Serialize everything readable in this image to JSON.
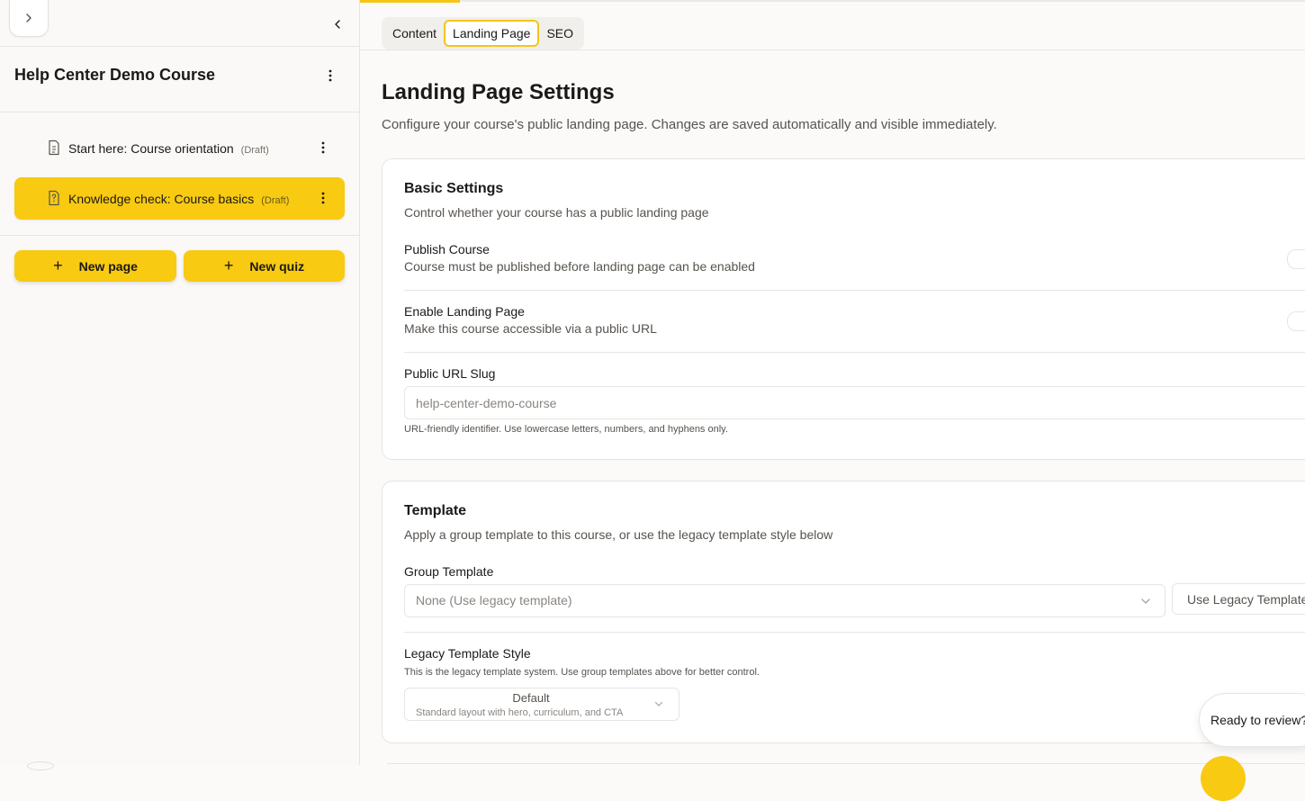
{
  "sidebar": {
    "course_title": "Help Center Demo Course",
    "items": [
      {
        "label": "Start here: Course orientation",
        "status": "(Draft)",
        "icon": "document-icon",
        "active": false
      },
      {
        "label": "Knowledge check: Course basics",
        "status": "(Draft)",
        "icon": "quiz-icon",
        "active": true
      }
    ],
    "new_page_label": "New page",
    "new_quiz_label": "New quiz"
  },
  "tabs": [
    "Content",
    "Landing Page",
    "SEO"
  ],
  "active_tab": "Landing Page",
  "page": {
    "title": "Landing Page Settings",
    "subtitle": "Configure your course's public landing page. Changes are saved automatically and visible immediately."
  },
  "basic": {
    "title": "Basic Settings",
    "subtitle": "Control whether your course has a public landing page",
    "publish_label": "Publish Course",
    "publish_desc": "Course must be published before landing page can be enabled",
    "enable_label": "Enable Landing Page",
    "enable_desc": "Make this course accessible via a public URL",
    "slug_label": "Public URL Slug",
    "slug_placeholder": "help-center-demo-course",
    "slug_hint": "URL-friendly identifier. Use lowercase letters, numbers, and hyphens only."
  },
  "template": {
    "title": "Template",
    "subtitle": "Apply a group template to this course, or use the legacy template style below",
    "group_label": "Group Template",
    "group_value": "None (Use legacy template)",
    "legacy_button": "Use Legacy Template",
    "legacy_label": "Legacy Template Style",
    "legacy_hint": "This is the legacy template system. Use group templates above for better control.",
    "style_value": "Default",
    "style_desc": "Standard layout with hero, curriculum, and CTA"
  },
  "review": {
    "label": "Ready to review?"
  },
  "colors": {
    "accent": "#f8ca12",
    "border": "#e7e5e2",
    "background": "#fbfaf8"
  }
}
